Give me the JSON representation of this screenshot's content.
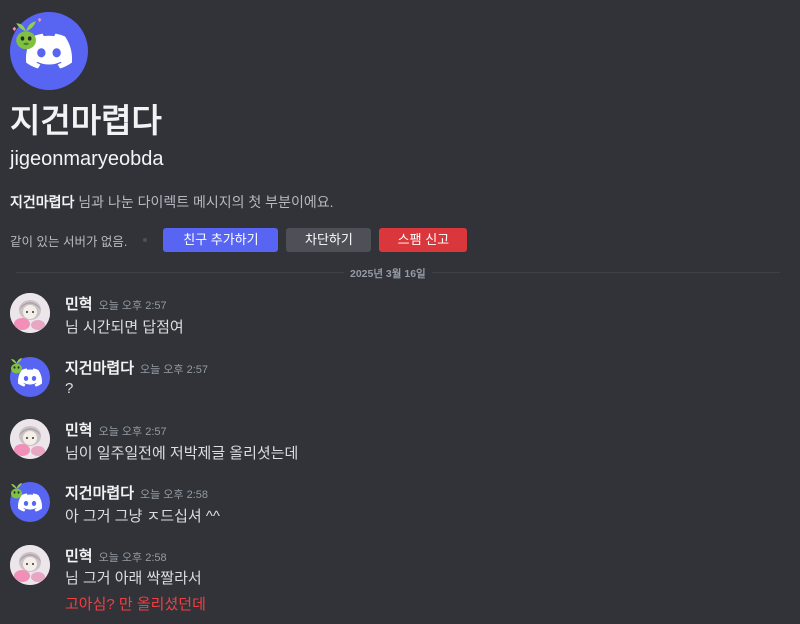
{
  "intro": {
    "display_name": "지건마렵다",
    "username": "jigeonmaryeobda",
    "description_name": "지건마렵다",
    "description_rest": " 님과 나눈 다이렉트 메시지의 첫 부분이에요.",
    "no_mutual_servers": "같이 있는 서버가 없음.",
    "buttons": {
      "add_friend": "친구 추가하기",
      "block": "차단하기",
      "report_spam": "스팸 신고"
    }
  },
  "divider": {
    "date": "2025년 3월 16일"
  },
  "messages": [
    {
      "author": "민혁",
      "time": "오늘 오후 2:57",
      "lines": [
        "님 시간되면 답점여"
      ]
    },
    {
      "author": "지건마렵다",
      "time": "오늘 오후 2:57",
      "lines": [
        "?"
      ]
    },
    {
      "author": "민혁",
      "time": "오늘 오후 2:57",
      "lines": [
        "님이 일주일전에 저박제글 올리셧는데"
      ]
    },
    {
      "author": "지건마렵다",
      "time": "오늘 오후 2:58",
      "lines": [
        "아 그거 그냥 ㅈ드십셔 ^^"
      ]
    },
    {
      "author": "민혁",
      "time": "오늘 오후 2:58",
      "lines": [
        "님 그거 아래 싹짤라서",
        "고아심? 만 올리셨던데"
      ]
    }
  ],
  "colors": {
    "background": "#313338",
    "blurple": "#5865f2",
    "danger": "#da373c",
    "red_text": "#f23f42",
    "gray_button": "#4e5058"
  },
  "icons": {
    "discord_logo": "discord-logo-icon",
    "sprout_decoration": "sprout-icon"
  }
}
